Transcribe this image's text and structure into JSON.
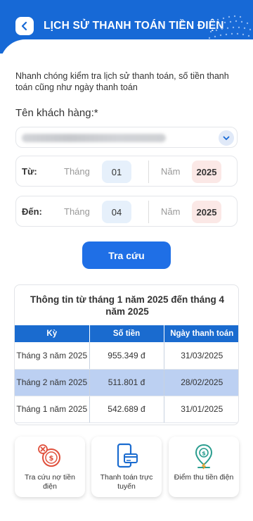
{
  "header": {
    "title": "LỊCH SỬ THANH TOÁN TIỀN ĐIỆN"
  },
  "intro": "Nhanh chóng kiểm tra lịch sử thanh toán, số tiền thanh toán cũng như ngày thanh toán",
  "customer": {
    "label": "Tên khách hàng:*"
  },
  "from": {
    "label": "Từ:",
    "month_label": "Tháng",
    "month": "01",
    "year_label": "Năm",
    "year": "2025"
  },
  "to": {
    "label": "Đến:",
    "month_label": "Tháng",
    "month": "04",
    "year_label": "Năm",
    "year": "2025"
  },
  "search_button": "Tra cứu",
  "result": {
    "title": "Thông tin từ tháng 1 năm 2025 đến tháng 4 năm 2025",
    "columns": [
      "Kỳ",
      "Số tiền",
      "Ngày thanh toán"
    ],
    "rows": [
      {
        "period": "Tháng 3 năm 2025",
        "amount": "955.349 đ",
        "date": "31/03/2025"
      },
      {
        "period": "Tháng 2 năm 2025",
        "amount": "511.801 đ",
        "date": "28/02/2025"
      },
      {
        "period": "Tháng 1 năm 2025",
        "amount": "542.689 đ",
        "date": "31/01/2025"
      }
    ]
  },
  "tiles": [
    {
      "label": "Tra cứu nợ tiền điện",
      "icon": "debt-lookup-icon"
    },
    {
      "label": "Thanh toán trực tuyến",
      "icon": "online-payment-icon"
    },
    {
      "label": "Điểm thu tiền điện",
      "icon": "collection-point-icon"
    }
  ],
  "colors": {
    "primary": "#1769d6",
    "highlight_row": "#bcd0f2",
    "accent_red": "#e0503c",
    "accent_teal": "#2a9d8f"
  }
}
